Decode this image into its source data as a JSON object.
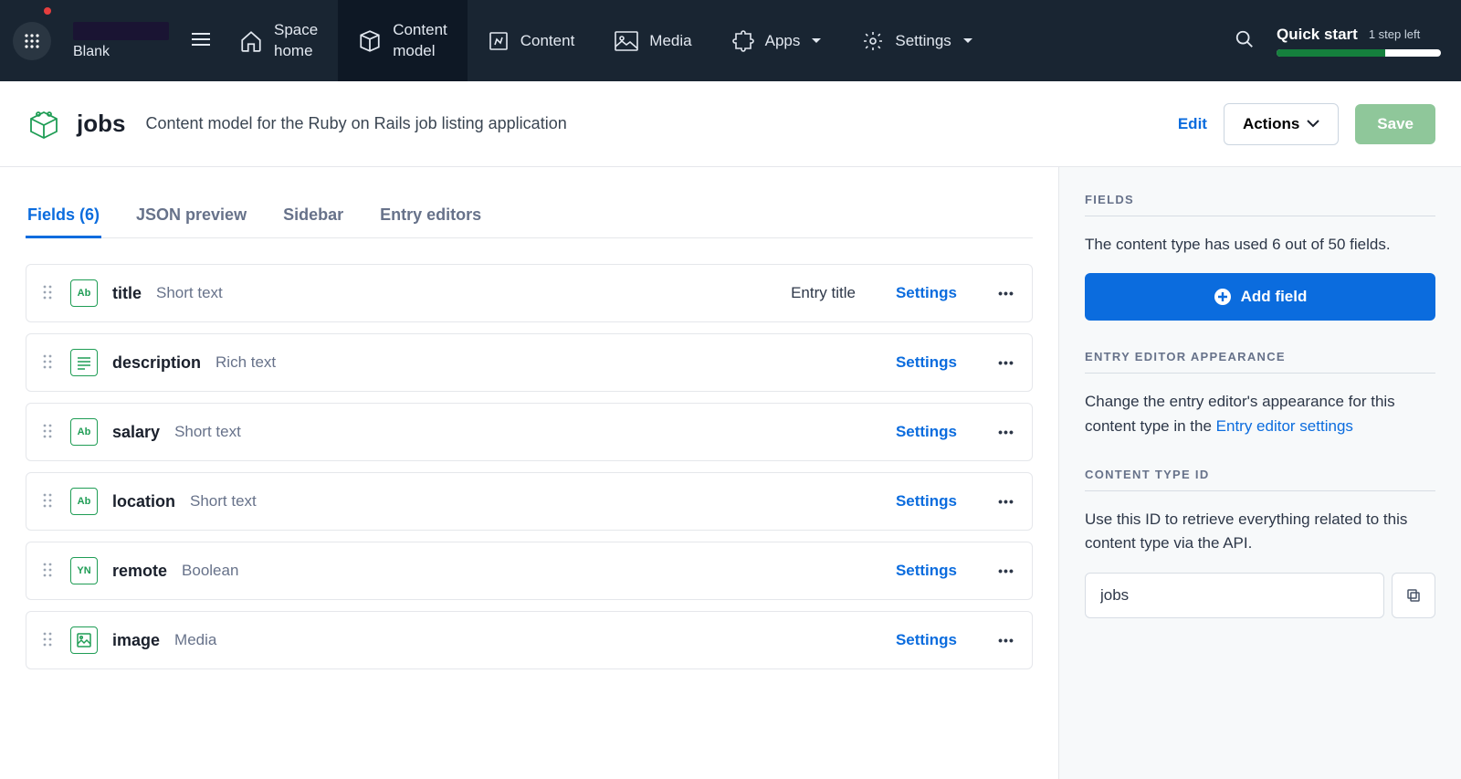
{
  "nav": {
    "space_label": "Blank",
    "items": {
      "space_home": "Space\nhome",
      "content_model": "Content\nmodel",
      "content": "Content",
      "media": "Media",
      "apps": "Apps",
      "settings": "Settings"
    },
    "quickstart": {
      "title": "Quick start",
      "step": "1 step left",
      "progress_pct": 66
    }
  },
  "titlebar": {
    "name": "jobs",
    "desc": "Content model for the Ruby on Rails job listing application",
    "edit": "Edit",
    "actions": "Actions",
    "save": "Save"
  },
  "tabs": {
    "fields": "Fields (6)",
    "json": "JSON preview",
    "sidebar": "Sidebar",
    "entry_editors": "Entry editors"
  },
  "field_rows": [
    {
      "badge": "Ab",
      "name": "title",
      "type": "Short text",
      "entry_title": "Entry title",
      "settings": "Settings"
    },
    {
      "badge": "RT",
      "name": "description",
      "type": "Rich text",
      "entry_title": "",
      "settings": "Settings"
    },
    {
      "badge": "Ab",
      "name": "salary",
      "type": "Short text",
      "entry_title": "",
      "settings": "Settings"
    },
    {
      "badge": "Ab",
      "name": "location",
      "type": "Short text",
      "entry_title": "",
      "settings": "Settings"
    },
    {
      "badge": "YN",
      "name": "remote",
      "type": "Boolean",
      "entry_title": "",
      "settings": "Settings"
    },
    {
      "badge": "IMG",
      "name": "image",
      "type": "Media",
      "entry_title": "",
      "settings": "Settings"
    }
  ],
  "sidebar_panel": {
    "fields_h": "Fields",
    "fields_p": "The content type has used 6 out of 50 fields.",
    "add_field": "Add field",
    "appearance_h": "Entry Editor Appearance",
    "appearance_p_pre": "Change the entry editor's appearance for this content type in the ",
    "appearance_link": "Entry editor settings",
    "ctid_h": "Content Type ID",
    "ctid_p": "Use this ID to retrieve everything related to this content type via the API.",
    "ctid_value": "jobs"
  }
}
